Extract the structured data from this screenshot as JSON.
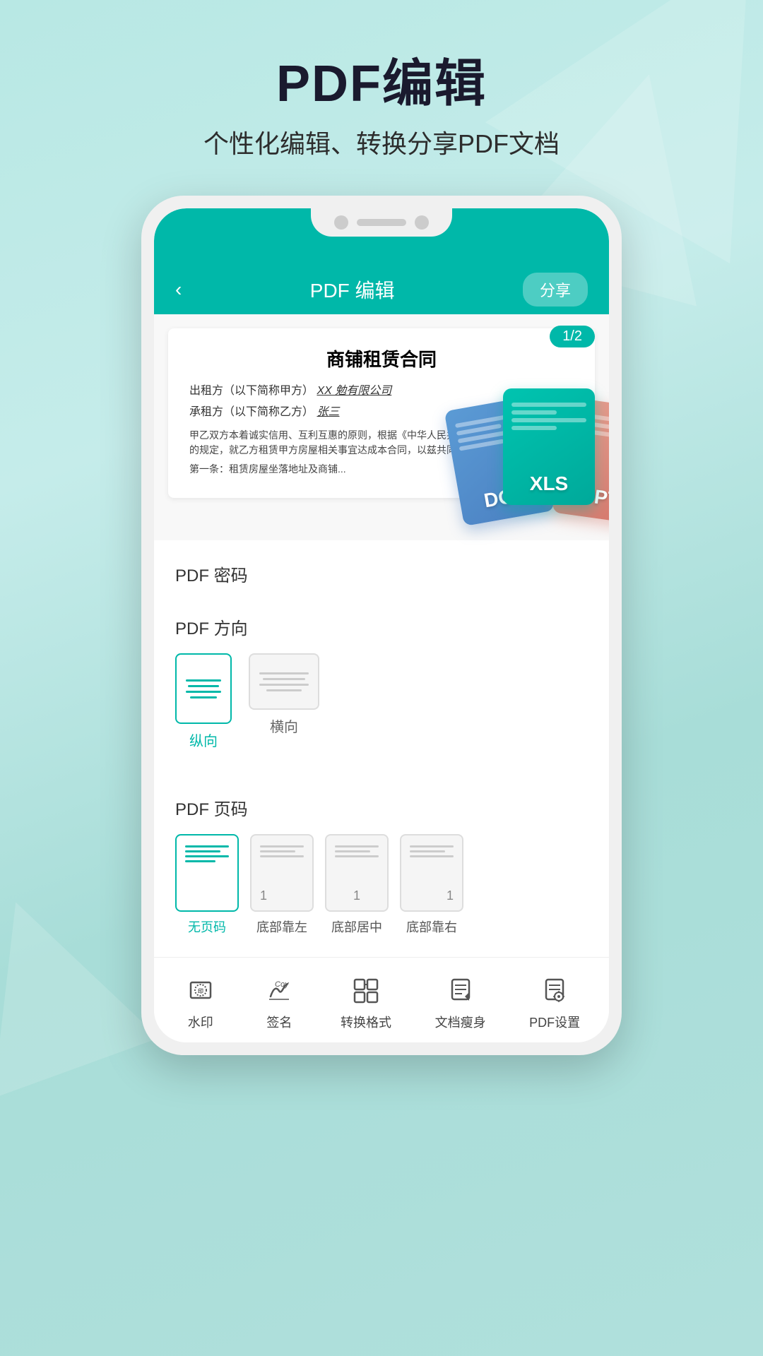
{
  "background": {
    "color_start": "#b8e8e4",
    "color_end": "#a8ddd8"
  },
  "header": {
    "main_title": "PDF编辑",
    "sub_title": "个性化编辑、转换分享PDF文档"
  },
  "app_bar": {
    "title": "PDF 编辑",
    "back_icon": "‹",
    "share_btn": "分享"
  },
  "document": {
    "page_badge": "1/2",
    "doc_title": "商铺租赁合同",
    "line1_label": "出租方（以下简称甲方）",
    "line1_value": "XX 勉有限公司",
    "line2_label": "承租方（以下简称乙方）",
    "line2_value": "张三",
    "body_text": "甲乙双方本着诚实信用、互利互惠的原则，根据《中华人民共和国合同法》法律、法规的规定，就乙方租赁甲方房屋相关事宜达成本合同，以兹共同遵守：",
    "article_text": "第一条：租赁房屋坐落地址及商铺..."
  },
  "pdf_password": {
    "section_title": "PDF 密码"
  },
  "pdf_orientation": {
    "section_title": "PDF 方向",
    "portrait_label": "纵向",
    "landscape_label": "横向",
    "portrait_active": true
  },
  "pdf_page_number": {
    "section_title": "PDF 页码",
    "options": [
      {
        "label": "无页码",
        "active": true,
        "number": ""
      },
      {
        "label": "底部靠左",
        "active": false,
        "number": "1"
      },
      {
        "label": "底部居中",
        "active": false,
        "number": "1"
      },
      {
        "label": "底部靠右",
        "active": false,
        "number": "1"
      }
    ]
  },
  "toolbar": {
    "items": [
      {
        "name": "watermark",
        "label": "水印",
        "icon": "watermark"
      },
      {
        "name": "signature",
        "label": "签名",
        "icon": "signature"
      },
      {
        "name": "convert",
        "label": "转换格式",
        "icon": "convert"
      },
      {
        "name": "slim",
        "label": "文档瘦身",
        "icon": "slim"
      },
      {
        "name": "settings",
        "label": "PDF设置",
        "icon": "settings"
      }
    ]
  },
  "file_cards": [
    {
      "type": "DOC",
      "color": "#4a7fc1"
    },
    {
      "type": "XLS",
      "color": "#00a99a"
    },
    {
      "type": "PPT",
      "color": "#d4756a"
    }
  ]
}
